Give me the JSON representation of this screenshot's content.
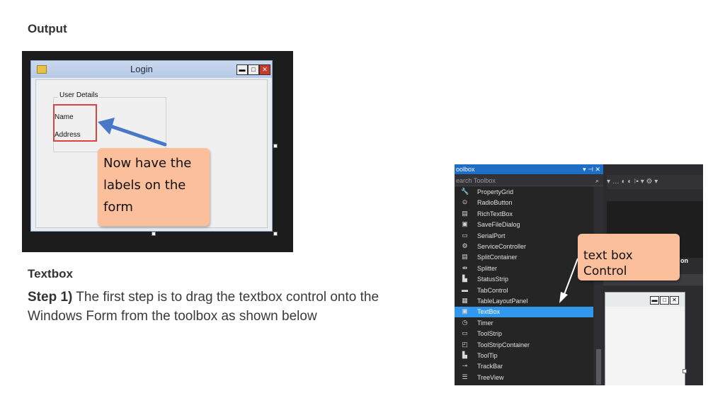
{
  "headings": {
    "output": "Output",
    "textbox": "Textbox"
  },
  "step": {
    "label": "Step 1)",
    "text": "The first step is to drag the textbox control onto the Windows Form from the toolbox as shown below"
  },
  "login_window": {
    "title": "Login",
    "group_title": "User Details",
    "labels": [
      "Name",
      "Address"
    ],
    "minimize_glyph": "▬",
    "maximize_glyph": "□",
    "close_glyph": "✕"
  },
  "callouts": {
    "labels_note": [
      "Now have the",
      "labels on the",
      "form"
    ],
    "textbox_note": "text box Control"
  },
  "toolbox": {
    "title": "oolbox",
    "header_controls": "▾ ⊣ ✕",
    "search_placeholder": "earch Toolbox",
    "search_icon": "⌕",
    "ide_toolbar": "▾ …  ◐ ◐  ⁝▪ ▾  ⚙ ▾",
    "ide_fragment": "on",
    "items": [
      {
        "label": "PropertyGrid",
        "icon": "🔧",
        "icon_name": "wrench-icon"
      },
      {
        "label": "RadioButton",
        "icon": "⊙",
        "icon_name": "radio-icon"
      },
      {
        "label": "RichTextBox",
        "icon": "▤",
        "icon_name": "richtext-icon"
      },
      {
        "label": "SaveFileDialog",
        "icon": "▣",
        "icon_name": "save-dialog-icon"
      },
      {
        "label": "SerialPort",
        "icon": "▭",
        "icon_name": "serial-port-icon"
      },
      {
        "label": "ServiceController",
        "icon": "⚙",
        "icon_name": "service-icon"
      },
      {
        "label": "SplitContainer",
        "icon": "▤",
        "icon_name": "split-container-icon"
      },
      {
        "label": "Splitter",
        "icon": "⇹",
        "icon_name": "splitter-icon"
      },
      {
        "label": "StatusStrip",
        "icon": "▙",
        "icon_name": "status-strip-icon"
      },
      {
        "label": "TabControl",
        "icon": "▬",
        "icon_name": "tab-control-icon"
      },
      {
        "label": "TableLayoutPanel",
        "icon": "▦",
        "icon_name": "table-layout-icon"
      },
      {
        "label": "TextBox",
        "icon": "▣",
        "icon_name": "textbox-icon",
        "selected": true
      },
      {
        "label": "Timer",
        "icon": "◷",
        "icon_name": "timer-icon"
      },
      {
        "label": "ToolStrip",
        "icon": "▭",
        "icon_name": "toolstrip-icon"
      },
      {
        "label": "ToolStripContainer",
        "icon": "◰",
        "icon_name": "toolstrip-container-icon"
      },
      {
        "label": "ToolTip",
        "icon": "▙",
        "icon_name": "tooltip-icon"
      },
      {
        "label": "TrackBar",
        "icon": "⊸",
        "icon_name": "trackbar-icon"
      },
      {
        "label": "TreeView",
        "icon": "☰",
        "icon_name": "treeview-icon"
      }
    ]
  },
  "colors": {
    "note": "#fbbf9c",
    "arrow": "#4a78c9",
    "highlight": "#d8453e",
    "selected_item": "#3298ee"
  }
}
